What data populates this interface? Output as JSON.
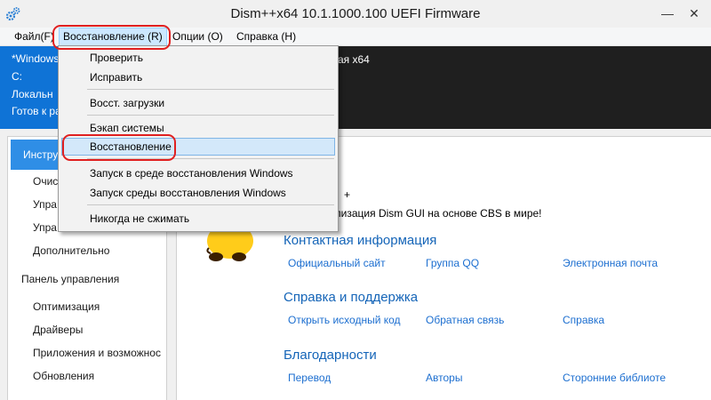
{
  "window": {
    "title": "Dism++x64 10.1.1000.100 UEFI Firmware",
    "minimize_glyph": "—",
    "close_glyph": "✕",
    "app_icon": "gears-icon"
  },
  "menubar": {
    "items": [
      {
        "label": "Файл(F)"
      },
      {
        "label": "Восстановление (R)"
      },
      {
        "label": "Опции (O)"
      },
      {
        "label": "Справка (H)"
      }
    ]
  },
  "info_panel": {
    "lines": [
      "*Windows",
      "C:",
      "Локальн",
      "Готов к ра"
    ],
    "right_text": "ая x64"
  },
  "sidebar": {
    "selected_label": "Инстру",
    "items": [
      "Очис",
      "Упра",
      "Упра",
      "Дополнительно",
      "Панель управления",
      "Оптимизация",
      "Драйверы",
      "Приложения и возможнос",
      "Обновления"
    ]
  },
  "main": {
    "about_line1": "+",
    "about_line2": "ализация Dism GUI на основе CBS в мире!",
    "sections": [
      {
        "title": "Контактная информация",
        "links": [
          "Официальный сайт",
          "Группа QQ",
          "Электронная почта"
        ]
      },
      {
        "title": "Справка и поддержка",
        "links": [
          "Открыть исходный код",
          "Обратная связь",
          "Справка"
        ]
      },
      {
        "title": "Благодарности",
        "links": [
          "Перевод",
          "Авторы",
          "Сторонние библиоте"
        ]
      }
    ]
  },
  "dropdown": {
    "items": [
      "Проверить",
      "Исправить",
      "Восст. загрузки",
      "Бэкап системы",
      "Восстановление",
      "Запуск в среде восстановления Windows",
      "Запуск среды восстановления Windows",
      "Никогда не сжимать"
    ],
    "selected_item": "Восстановление"
  },
  "colors": {
    "accent": "#0f73d6",
    "link": "#1d6fd0",
    "section_title": "#1565b8",
    "highlight_ring": "#e02020"
  }
}
